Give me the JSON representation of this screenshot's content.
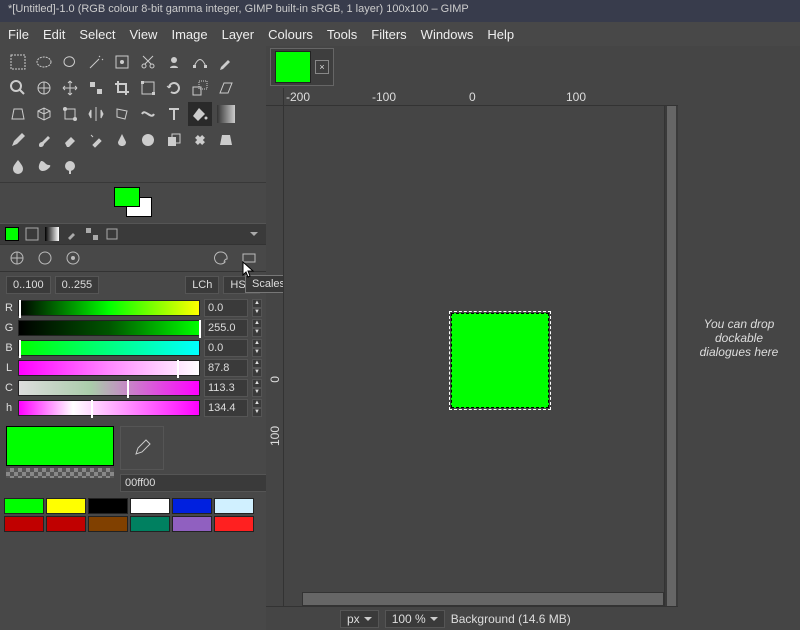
{
  "title": "*[Untitled]-1.0 (RGB colour 8-bit gamma integer, GIMP built-in sRGB, 1 layer) 100x100 – GIMP",
  "menu": [
    "File",
    "Edit",
    "Select",
    "View",
    "Image",
    "Layer",
    "Colours",
    "Tools",
    "Filters",
    "Windows",
    "Help"
  ],
  "fg_color": "#00ff00",
  "bg_color": "#ffffff",
  "range": {
    "a": "0..100",
    "b": "0..255"
  },
  "format_tabs": {
    "a": "LCh",
    "b": "HSV"
  },
  "tooltip": "Scales",
  "sliders": [
    {
      "label": "R",
      "val": "0.0",
      "grad": "linear-gradient(to right,#000,#0f0 50%,#ff0)",
      "pos": 0
    },
    {
      "label": "G",
      "val": "255.0",
      "grad": "linear-gradient(to right,#000,#050,#0f0)",
      "pos": 100
    },
    {
      "label": "B",
      "val": "0.0",
      "grad": "linear-gradient(to right,#0f0,#0ff)",
      "pos": 0
    },
    {
      "label": "L",
      "val": "87.8",
      "grad": "linear-gradient(to right,#f0f,#f8f,#fff)",
      "pos": 88
    },
    {
      "label": "C",
      "val": "113.3",
      "grad": "linear-gradient(to right,#ddd,#aca 40%,#f0f)",
      "pos": 60
    },
    {
      "label": "h",
      "val": "134.4",
      "grad": "linear-gradient(to right,#f0f,#fff 30%,#f0f)",
      "pos": 40
    }
  ],
  "hex": "00ff00",
  "palette": [
    "#00ff00",
    "#ffff00",
    "#000000",
    "#ffffff",
    "#0020df",
    "#d0f0ff",
    "#c00000",
    "#c00000",
    "#804000",
    "#008060",
    "#9060c0",
    "#ff2020"
  ],
  "ruler_h": [
    "-200",
    "-100",
    "0",
    "100"
  ],
  "ruler_v": [
    "0",
    "100"
  ],
  "status": {
    "unit": "px",
    "zoom": "100 %",
    "layer": "Background (14.6 MB)"
  },
  "dock_hint": "You can drop dockable dialogues here"
}
